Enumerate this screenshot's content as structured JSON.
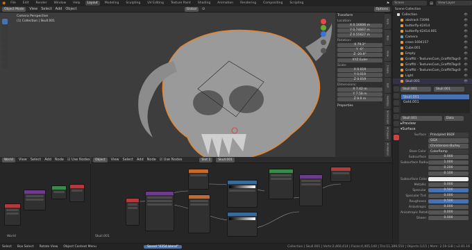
{
  "topmenu": {
    "file": "File",
    "edit": "Edit",
    "render": "Render",
    "window": "Window",
    "help": "Help"
  },
  "workspaces": [
    "Layout",
    "Modeling",
    "Sculpting",
    "UV Editing",
    "Texture Paint",
    "Shading",
    "Animation",
    "Rendering",
    "Compositing",
    "Scripting"
  ],
  "scene": "Scene",
  "view_layer": "View Layer",
  "options": "Options",
  "viewport": {
    "mode": "Object Mode",
    "view": "View",
    "select": "Select",
    "add": "Add",
    "object": "Object",
    "global": "Global",
    "overlay_title": "Camera Perspective",
    "overlay_sub": "(1) Collection | Skull.001"
  },
  "transform": {
    "title": "Transform",
    "location": "Location:",
    "loc": [
      {
        "a": "X",
        "v": "0.16606 m"
      },
      {
        "a": "Y",
        "v": "0.74667 m"
      },
      {
        "a": "Z",
        "v": "0.55627 m"
      }
    ],
    "rotation": "Rotation:",
    "rot": [
      {
        "a": "X",
        "v": "79.3°"
      },
      {
        "a": "Y",
        "v": "-0°"
      },
      {
        "a": "Z",
        "v": "-20.9°"
      }
    ],
    "euler": "XYZ Euler",
    "scale": "Scale:",
    "scl": [
      {
        "a": "X",
        "v": "0.019"
      },
      {
        "a": "Y",
        "v": "0.019"
      },
      {
        "a": "Z",
        "v": "0.019"
      }
    ],
    "dimensions": "Dimensions:",
    "dim": [
      {
        "a": "X",
        "v": "7.42 m"
      },
      {
        "a": "Y",
        "v": "7.58 m"
      },
      {
        "a": "Z",
        "v": "9.9 m"
      }
    ],
    "properties": "Properties"
  },
  "sidetabs": [
    "Item",
    "Tool",
    "View",
    "Create",
    "Edit",
    "HardOps",
    "Screencast",
    "Archipack",
    "Animation",
    "Shape Keys"
  ],
  "outliner": {
    "title": "Scene Collection",
    "items": [
      "Collection",
      "abstract-73096",
      "butterfly-42414",
      "butterfly-42414.001",
      "Camera",
      "cross-1694157",
      "Cube.001",
      "Empty",
      "Graffiti - TexturesCom_GraffitiTags0",
      "Graffiti - TexturesCom_GraffitiTags0",
      "Graffiti - TexturesCom_GraffitiTags0",
      "Graffiti - TexturesCom_GraffitiTags0",
      "Light",
      "Skull.001"
    ]
  },
  "properties": {
    "obj1": "Skull.001",
    "obj2": "Skull.001",
    "slot1": "Skull.001",
    "slot2": "Gold.001",
    "mat": "Skull.001",
    "data": "Data",
    "preview": "Preview",
    "surface": "Surface",
    "rows": [
      {
        "l": "Surface",
        "v": "Principled BSDF"
      },
      {
        "l": "",
        "v": "GGX"
      },
      {
        "l": "",
        "v": "Christensen-Burley"
      },
      {
        "l": "Base Color",
        "v": "ColorRamp"
      },
      {
        "l": "Subsurface",
        "v": "0.000"
      },
      {
        "l": "Subsurface Radius",
        "v": "1.000"
      },
      {
        "l": "",
        "v": "0.200"
      },
      {
        "l": "",
        "v": "0.100"
      },
      {
        "l": "Subsurface Color",
        "v": ""
      },
      {
        "l": "Metallic",
        "v": "0.000"
      },
      {
        "l": "Specular",
        "v": "0.500"
      },
      {
        "l": "Specular Tint",
        "v": "0.000"
      },
      {
        "l": "Roughness",
        "v": "0.500"
      },
      {
        "l": "Anisotropic",
        "v": "0.000"
      },
      {
        "l": "Anisotropic Rotation",
        "v": "0.000"
      },
      {
        "l": "Sheen",
        "v": "0.000"
      }
    ]
  },
  "shader": {
    "world": "World",
    "view": "View",
    "select": "Select",
    "add": "Add",
    "node": "Node",
    "use_nodes": "Use Nodes",
    "object": "Object",
    "use_nodes2": "Use Nodes",
    "slot": "Slot 1",
    "mat": "Skull.001",
    "left_label": "World",
    "center_label": "Skull.001"
  },
  "status": {
    "select": "Select",
    "box": "Box Select",
    "rotate": "Rotate View",
    "menu": "Object Context Menu",
    "saved": "Saved \"0354.blend\"",
    "stats": "Collection | Skull.001 | Verts:2,460,414 | Faces:4,405,140 | Tris:11,389,550 | Objects:1/15 | Mem: 2.59 GiB | v2.81.16"
  }
}
